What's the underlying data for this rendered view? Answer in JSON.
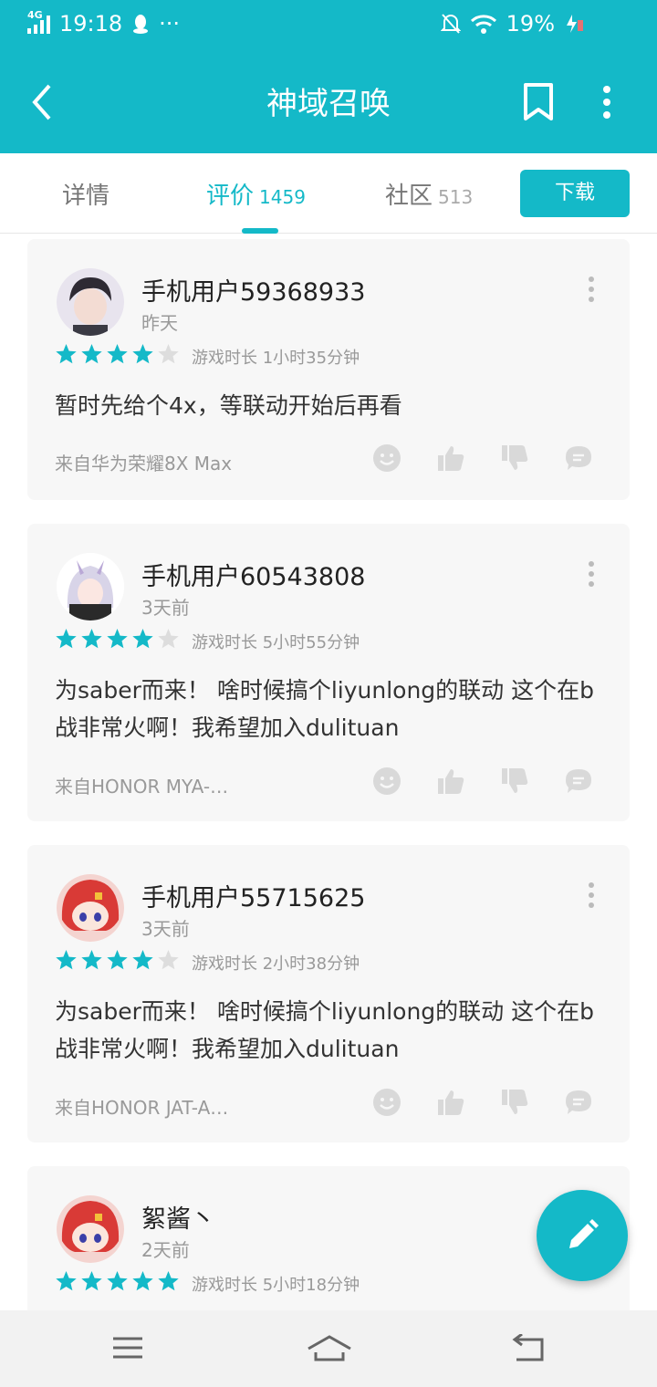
{
  "status_bar": {
    "time": "19:18",
    "network": "4G",
    "dots": "···",
    "battery": "19%"
  },
  "header": {
    "title": "神域召唤"
  },
  "tabs": [
    {
      "label": "详情",
      "count": ""
    },
    {
      "label": "评价",
      "count": "1459"
    },
    {
      "label": "社区",
      "count": "513"
    }
  ],
  "download_label": "下载",
  "reviews": [
    {
      "user": "手机用户59368933",
      "date": "昨天",
      "rating": 4,
      "playtime": "游戏时长 1小时35分钟",
      "content": "暂时先给个4x，等联动开始后再看",
      "device": "来自华为荣耀8X Max"
    },
    {
      "user": "手机用户60543808",
      "date": "3天前",
      "rating": 4,
      "playtime": "游戏时长 5小时55分钟",
      "content": "为saber而来！ 啥时候搞个liyunlong的联动 这个在b战非常火啊！我希望加入dulituan",
      "device": "来自HONOR MYA-…"
    },
    {
      "user": "手机用户55715625",
      "date": "3天前",
      "rating": 4,
      "playtime": "游戏时长 2小时38分钟",
      "content": "为saber而来！ 啥时候搞个liyunlong的联动 这个在b战非常火啊！我希望加入dulituan",
      "device": "来自HONOR JAT-A…"
    },
    {
      "user": "絮酱丶",
      "date": "2天前",
      "rating": 5,
      "playtime": "游戏时长 5小时18分钟",
      "content": "",
      "device": ""
    }
  ],
  "colors": {
    "accent": "#14b9c8",
    "star_on": "#14b9c8",
    "star_off": "#dddddd"
  }
}
